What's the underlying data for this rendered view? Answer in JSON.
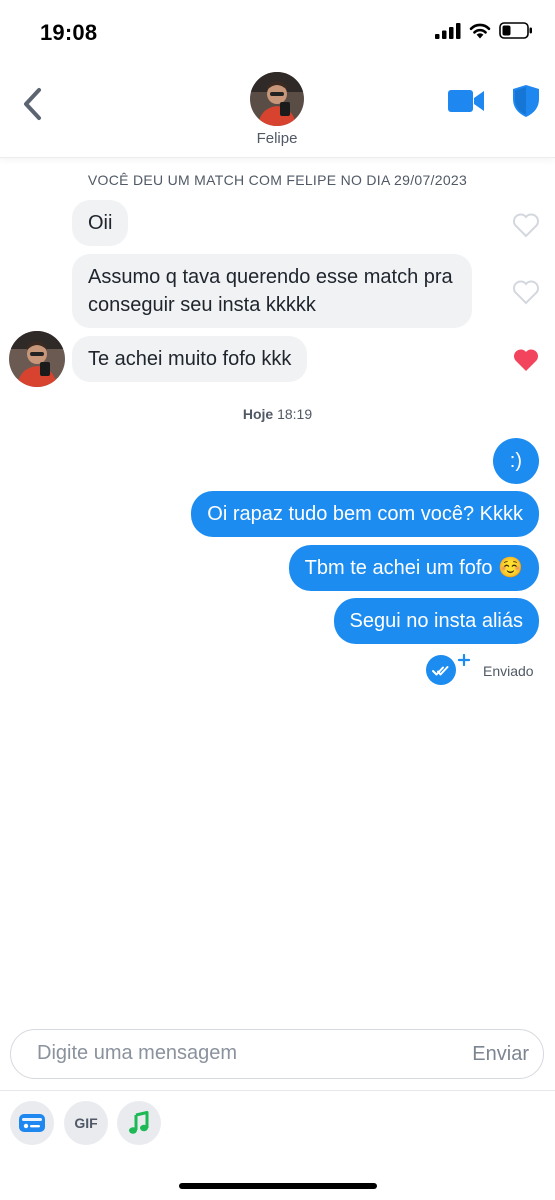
{
  "status_bar": {
    "time": "19:08"
  },
  "header": {
    "contact_name": "Felipe",
    "icons": {
      "back": "chevron-left-icon",
      "video": "video-camera-icon",
      "safety": "shield-icon"
    }
  },
  "conversation": {
    "match_notice": "VOCÊ DEU UM MATCH COM FELIPE NO DIA 29/07/2023",
    "incoming": [
      {
        "text": "Oii",
        "liked": false
      },
      {
        "text": "Assumo q tava querendo esse match pra conseguir seu insta kkkkk",
        "liked": false
      },
      {
        "text": "Te achei muito fofo kkk",
        "liked": true
      }
    ],
    "day_separator": {
      "day": "Hoje",
      "time": "18:19"
    },
    "outgoing": [
      {
        "text": ":)"
      },
      {
        "text": "Oi rapaz tudo bem com você? Kkkk"
      },
      {
        "text": "Tbm te achei um fofo ☺️"
      },
      {
        "text": "Segui no insta aliás"
      }
    ],
    "status": "Enviado"
  },
  "composer": {
    "placeholder": "Digite uma mensagem",
    "send_label": "Enviar",
    "tools": [
      {
        "name": "sticker-card-icon"
      },
      {
        "label": "GIF"
      },
      {
        "name": "music-note-icon"
      }
    ]
  },
  "colors": {
    "outgoing_bubble": "#1c8cf0",
    "incoming_bubble": "#f0f2f4",
    "like_heart": "#f2445c",
    "header_icon": "#1e88f0"
  }
}
